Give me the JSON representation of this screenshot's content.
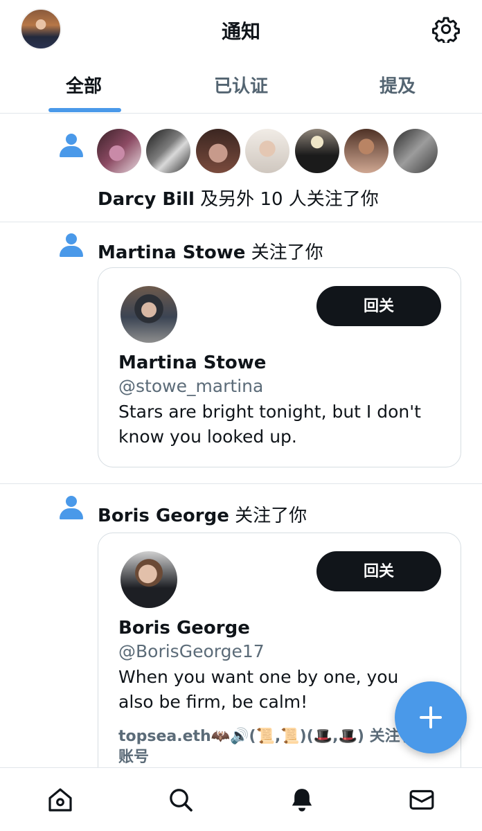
{
  "header": {
    "title": "通知"
  },
  "tabs": [
    {
      "label": "全部",
      "active": true
    },
    {
      "label": "已认证",
      "active": false
    },
    {
      "label": "提及",
      "active": false
    }
  ],
  "group_follow": {
    "name": "Darcy Bill",
    "text": " 及另外 10 人关注了你",
    "avatar_count": 7
  },
  "follows": [
    {
      "name": "Martina Stowe",
      "action": " 关注了你",
      "button": "回关",
      "handle": "@stowe_martina",
      "bio": "Stars are bright tonight, but I don't know you looked up.",
      "followed_by": ""
    },
    {
      "name": "Boris George",
      "action": " 关注了你",
      "button": "回关",
      "handle": "@BorisGeorge17",
      "bio": "When you want one by one, you also be firm, be calm!",
      "followed_by": "topsea.eth🦇🔊(📜,📜)(🎩,🎩) 关注了此账号"
    }
  ],
  "nav": [
    "home-icon",
    "search-icon",
    "bell-icon",
    "mail-icon"
  ],
  "colors": {
    "accent": "#4a99e9",
    "button": "#11151a"
  }
}
